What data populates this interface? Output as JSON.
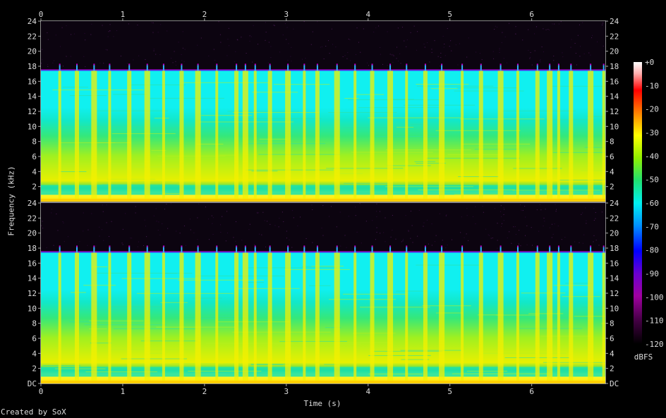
{
  "chart_data": {
    "type": "heatmap",
    "title": "",
    "xlabel": "Time (s)",
    "ylabel": "Frequency (kHz)",
    "x_ticks": [
      "0",
      "1",
      "2",
      "3",
      "4",
      "5",
      "6"
    ],
    "xlim": [
      0,
      6.9
    ],
    "ylim": [
      0,
      24
    ],
    "y_ticks_top": [
      "2",
      "4",
      "6",
      "8",
      "10",
      "12",
      "14",
      "16",
      "18",
      "20",
      "22",
      "24"
    ],
    "y_ticks_bottom": [
      "DC",
      "2",
      "4",
      "6",
      "8",
      "10",
      "12",
      "14",
      "16",
      "18",
      "20",
      "22",
      "24"
    ],
    "channels": 2,
    "cutoff_khz": 17.4,
    "colorbar": {
      "unit": "dBFS",
      "ticks": [
        "+0",
        "-10",
        "-20",
        "-30",
        "-40",
        "-50",
        "-60",
        "-70",
        "-80",
        "-90",
        "-100",
        "-110",
        "-120"
      ],
      "range": [
        -120,
        0
      ]
    },
    "transient_times_s": [
      0.23,
      0.44,
      0.65,
      0.84,
      1.08,
      1.3,
      1.5,
      1.72,
      1.92,
      2.15,
      2.39,
      2.5,
      2.62,
      2.8,
      3.02,
      3.22,
      3.38,
      3.62,
      3.84,
      4.05,
      4.27,
      4.47,
      4.7,
      4.9,
      5.15,
      5.38,
      5.62,
      5.83,
      6.07,
      6.22,
      6.33,
      6.48,
      6.72,
      6.88
    ]
  },
  "footer": {
    "credit": "Created by SoX"
  }
}
